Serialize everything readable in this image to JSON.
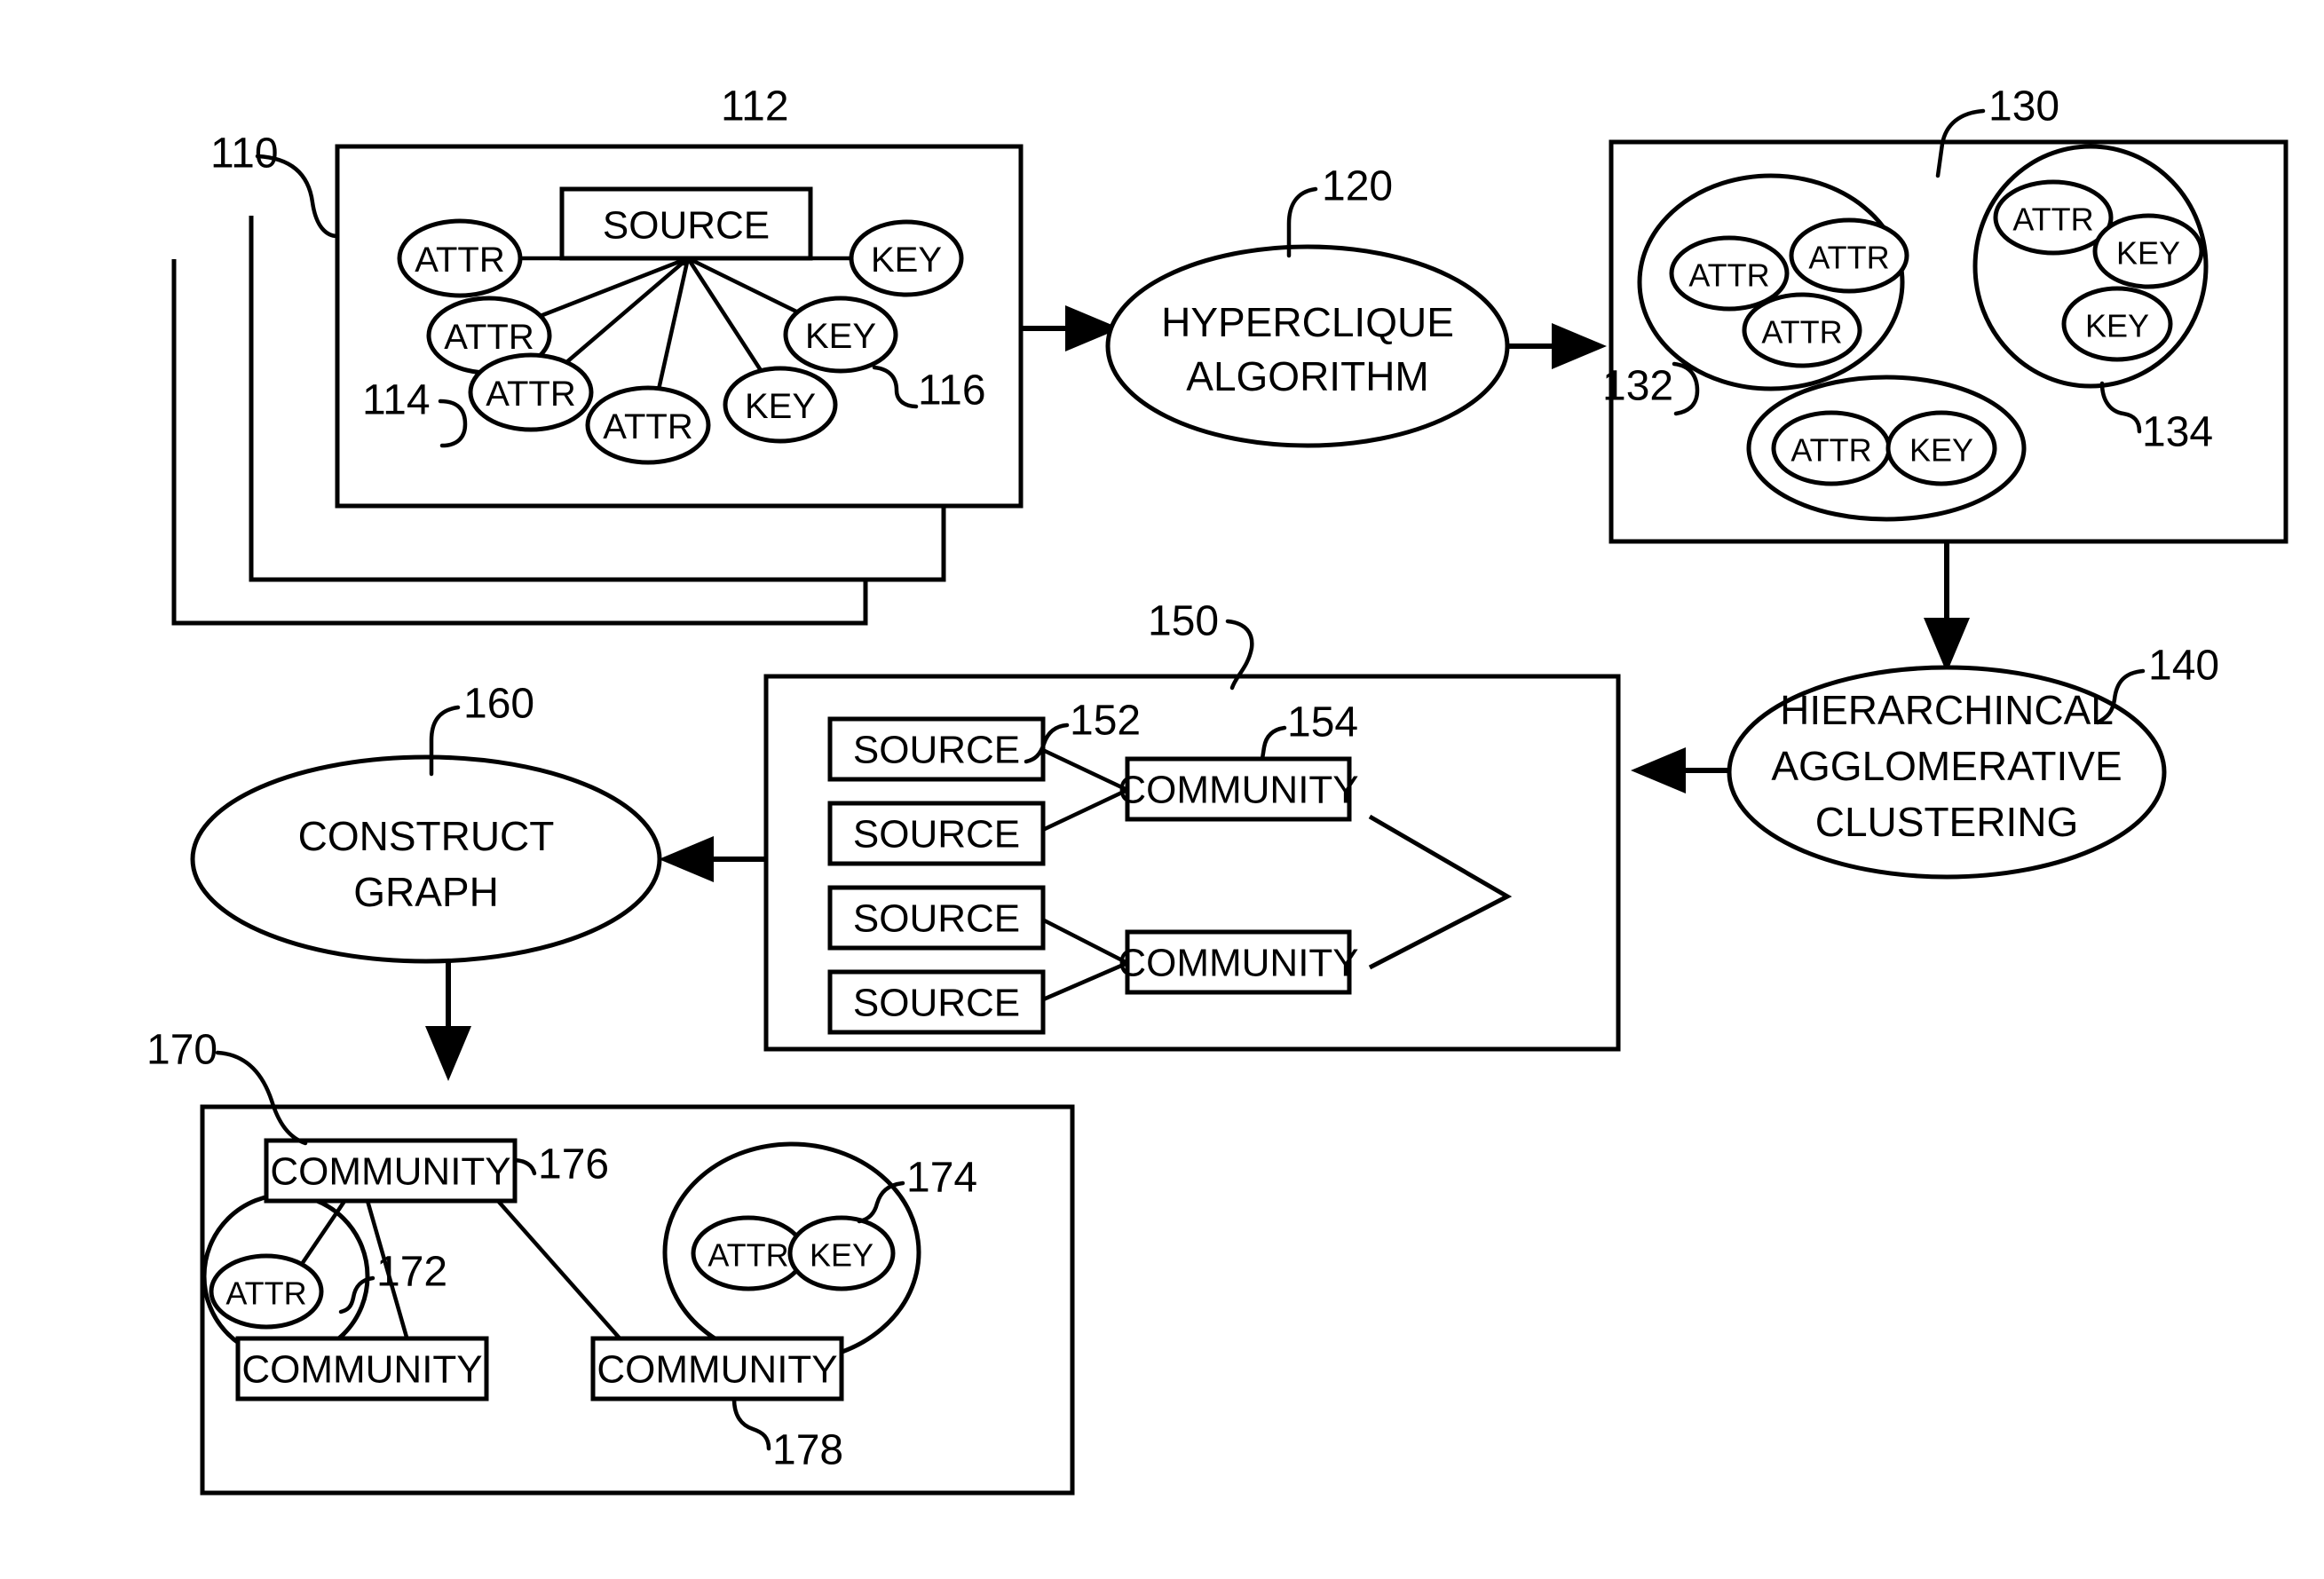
{
  "figure": {
    "title": "Data source clustering and community graph construction flow",
    "type": "patent-flow-diagram"
  },
  "labels": {
    "attr": "ATTR",
    "key": "KEY",
    "source": "SOURCE",
    "community": "COMMUNITY",
    "hyperclique": {
      "line1": "HYPERCLIQUE",
      "line2": "ALGORITHM"
    },
    "clustering": {
      "line1": "HIERARCHINCAL",
      "line2": "AGGLOMERATIVE",
      "line3": "CLUSTERING"
    },
    "construct_graph": {
      "line1": "CONSTRUCT",
      "line2": "GRAPH"
    }
  },
  "reference_numerals": {
    "n110": "110",
    "n112": "112",
    "n114": "114",
    "n116": "116",
    "n120": "120",
    "n130": "130",
    "n132": "132",
    "n134": "134",
    "n140": "140",
    "n150": "150",
    "n152": "152",
    "n154": "154",
    "n160": "160",
    "n170": "170",
    "n172": "172",
    "n174": "174",
    "n176": "176",
    "n178": "178"
  },
  "blocks": {
    "source_record_110": {
      "ref": "110",
      "stacked_copies": 3,
      "source_node_ref": "112",
      "attributes_ref": "114",
      "keys_ref": "116",
      "attr_count": 4,
      "key_count": 3
    },
    "clusters_130": {
      "ref": "130",
      "cluster_a_ref": "132",
      "cluster_a_members": [
        "ATTR",
        "ATTR",
        "ATTR"
      ],
      "cluster_b_ref": "134",
      "cluster_b_members": [
        "ATTR",
        "KEY",
        "KEY"
      ],
      "cluster_c_members": [
        "ATTR",
        "KEY"
      ]
    },
    "communities_150": {
      "ref": "150",
      "source_ref": "152",
      "community_ref": "154",
      "sources": [
        "SOURCE",
        "SOURCE",
        "SOURCE",
        "SOURCE"
      ],
      "communities": [
        "COMMUNITY",
        "COMMUNITY"
      ]
    },
    "graph_170": {
      "ref": "170",
      "top_community_ref": "176",
      "attr_group_ref": "172",
      "attr_key_group_ref": "174",
      "bottom_right_community_ref": "178",
      "communities": [
        "COMMUNITY",
        "COMMUNITY",
        "COMMUNITY"
      ]
    }
  },
  "processes": [
    {
      "ref": "120",
      "name": "hyperclique-algorithm"
    },
    {
      "ref": "140",
      "name": "hierarchical-agglomerative-clustering"
    },
    {
      "ref": "160",
      "name": "construct-graph"
    }
  ],
  "colors": {
    "stroke": "#000000",
    "background": "#ffffff"
  }
}
